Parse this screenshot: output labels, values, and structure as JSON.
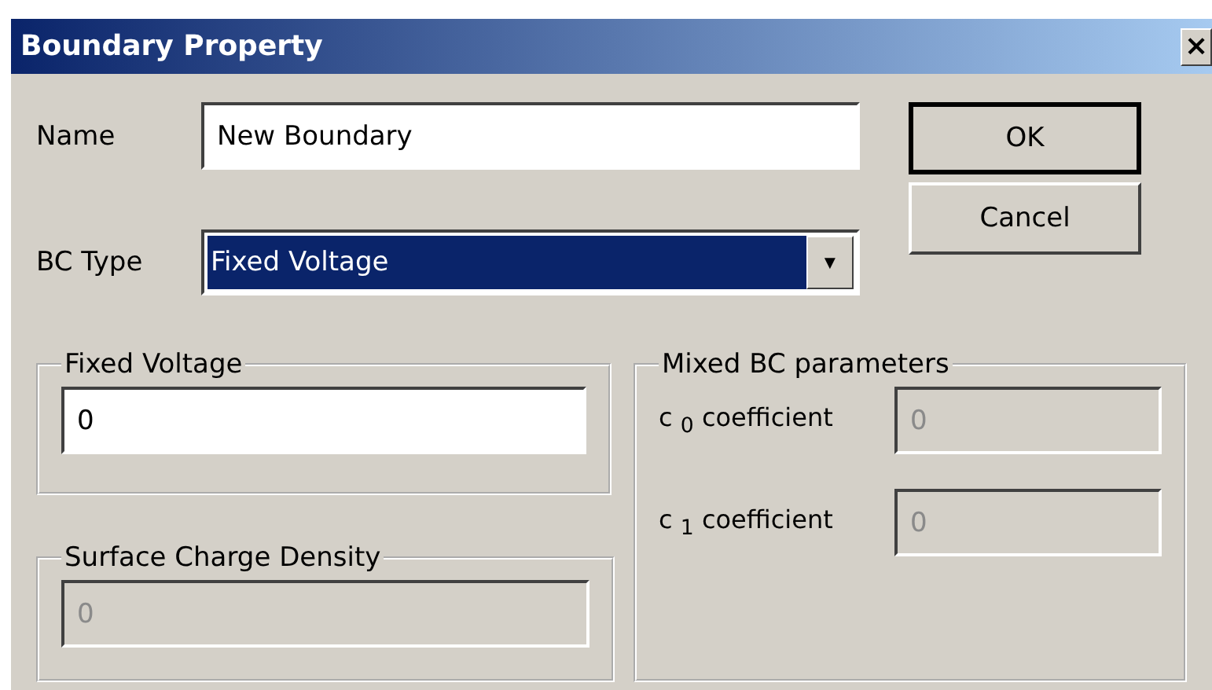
{
  "window": {
    "title": "Boundary Property",
    "close": "×"
  },
  "name_field": {
    "label": "Name",
    "value": "New Boundary"
  },
  "bc_type": {
    "label": "BC Type",
    "value": "Fixed Voltage",
    "focused": true,
    "arrow": "▼"
  },
  "buttons": [
    {
      "label": "OK",
      "default": true
    },
    {
      "label": "Cancel",
      "default": false
    }
  ],
  "fixed_voltage": {
    "title": "Fixed Voltage",
    "value": "0",
    "disabled": false
  },
  "surface_charge": {
    "title": "Surface Charge Density",
    "value": "0",
    "disabled": true
  },
  "mixed": {
    "title": "Mixed BC parameters",
    "rows": [
      {
        "label": "c $_{0}$ coefficient",
        "value": "0",
        "disabled": true
      },
      {
        "label": "c $_{1}$ coefficient",
        "value": "0",
        "disabled": true
      }
    ]
  }
}
